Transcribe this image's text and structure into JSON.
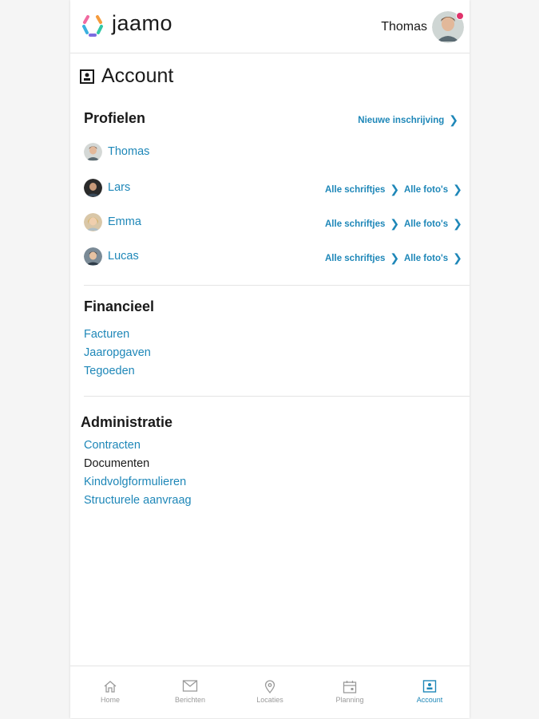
{
  "header": {
    "logo_text": "jaamo",
    "user_name": "Thomas"
  },
  "page": {
    "title": "Account"
  },
  "profielen": {
    "title": "Profielen",
    "new_link": "Nieuwe inschrijving",
    "profiles": [
      {
        "name": "Thomas",
        "links": []
      },
      {
        "name": "Lars",
        "links": [
          "Alle schriftjes",
          "Alle foto's"
        ]
      },
      {
        "name": "Emma",
        "links": [
          "Alle schriftjes",
          "Alle foto's"
        ]
      },
      {
        "name": "Lucas",
        "links": [
          "Alle schriftjes",
          "Alle foto's"
        ]
      }
    ]
  },
  "financieel": {
    "title": "Financieel",
    "items": [
      "Facturen",
      "Jaaropgaven",
      "Tegoeden"
    ]
  },
  "administratie": {
    "title": "Administratie",
    "items": [
      "Contracten",
      "Documenten",
      "Kindvolgformulieren",
      "Structurele aanvraag"
    ]
  },
  "nav": {
    "items": [
      {
        "label": "Home",
        "icon": "home-icon"
      },
      {
        "label": "Berichten",
        "icon": "mail-icon"
      },
      {
        "label": "Locaties",
        "icon": "location-pin-icon"
      },
      {
        "label": "Planning",
        "icon": "calendar-icon"
      },
      {
        "label": "Account",
        "icon": "account-card-icon",
        "active": true
      }
    ]
  },
  "colors": {
    "link": "#1e87b8",
    "text": "#1a1a1a",
    "notification": "#e0336b",
    "nav_inactive": "#9a9a9a"
  }
}
